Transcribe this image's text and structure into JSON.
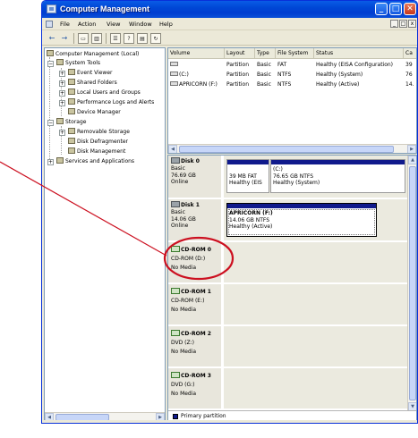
{
  "window": {
    "title": "Computer Management",
    "controls": {
      "minimize": "_",
      "maximize": "□",
      "close": "✕"
    }
  },
  "menu": {
    "items": [
      "File",
      "Action",
      "View",
      "Window",
      "Help"
    ],
    "mdi_controls": [
      "_",
      "□",
      "x"
    ]
  },
  "toolbar": {
    "icons": [
      "back-arrow-icon",
      "forward-arrow-icon",
      "up-folder-icon",
      "show-hide-tree-icon",
      "properties-icon",
      "help-icon",
      "export-list-icon",
      "refresh-icon"
    ]
  },
  "tree": {
    "root": "Computer Management (Local)",
    "items": [
      {
        "label": "System Tools",
        "icon": "tools-icon"
      },
      {
        "label": "Event Viewer",
        "icon": "event-viewer-icon"
      },
      {
        "label": "Shared Folders",
        "icon": "shared-folder-icon"
      },
      {
        "label": "Local Users and Groups",
        "icon": "users-icon"
      },
      {
        "label": "Performance Logs and Alerts",
        "icon": "performance-icon"
      },
      {
        "label": "Device Manager",
        "icon": "device-manager-icon"
      },
      {
        "label": "Storage",
        "icon": "storage-icon"
      },
      {
        "label": "Removable Storage",
        "icon": "removable-storage-icon"
      },
      {
        "label": "Disk Defragmenter",
        "icon": "defrag-icon"
      },
      {
        "label": "Disk Management",
        "icon": "disk-management-icon"
      },
      {
        "label": "Services and Applications",
        "icon": "services-icon"
      }
    ]
  },
  "volumes": {
    "headers": [
      "Volume",
      "Layout",
      "Type",
      "File System",
      "Status",
      "Ca"
    ],
    "rows": [
      [
        "",
        "Partition",
        "Basic",
        "FAT",
        "Healthy (EISA Configuration)",
        "39"
      ],
      [
        "(C:)",
        "Partition",
        "Basic",
        "NTFS",
        "Healthy (System)",
        "76"
      ],
      [
        "APRICORN (F:)",
        "Partition",
        "Basic",
        "NTFS",
        "Healthy (Active)",
        "14."
      ]
    ]
  },
  "disks": [
    {
      "name": "Disk 0",
      "type": "Basic",
      "size": "76.69 GB",
      "status": "Online",
      "partitions": [
        {
          "name": "",
          "detail": "39 MB FAT",
          "status": "Healthy (EIS"
        },
        {
          "name": "(C:)",
          "detail": "76.65 GB NTFS",
          "status": "Healthy (System)"
        }
      ]
    },
    {
      "name": "Disk 1",
      "type": "Basic",
      "size": "14.06 GB",
      "status": "Online",
      "partitions": [
        {
          "name": "APRICORN (F:)",
          "detail": "14.06 GB NTFS",
          "status": "Healthy (Active)"
        }
      ]
    },
    {
      "name": "CD-ROM 0",
      "type": "CD-ROM (D:)",
      "status": "No Media"
    },
    {
      "name": "CD-ROM 1",
      "type": "CD-ROM (E:)",
      "status": "No Media"
    },
    {
      "name": "CD-ROM 2",
      "type": "DVD (Z:)",
      "status": "No Media"
    },
    {
      "name": "CD-ROM 3",
      "type": "DVD (G:)",
      "status": "No Media"
    }
  ],
  "legend": {
    "label": "Primary partition",
    "color": "#101a8c"
  },
  "annotation": {
    "color": "#cc1020"
  }
}
